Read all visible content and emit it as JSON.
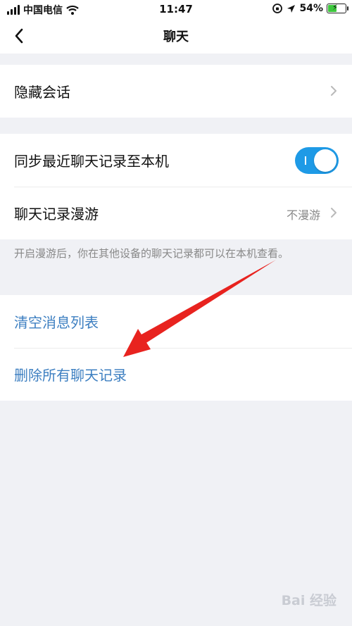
{
  "status": {
    "carrier": "中国电信",
    "time": "11:47",
    "battery_percent": "54%",
    "battery_level": 0.54
  },
  "nav": {
    "title": "聊天"
  },
  "hide_group": {
    "hide_sessions": "隐藏会话"
  },
  "sync_group": {
    "sync_recent": "同步最近聊天记录至本机",
    "sync_on": true,
    "roaming_label": "聊天记录漫游",
    "roaming_value": "不漫游"
  },
  "note": "开启漫游后，你在其他设备的聊天记录都可以在本机查看。",
  "action_group": {
    "clear_list": "清空消息列表",
    "delete_all": "删除所有聊天记录"
  },
  "colors": {
    "accent": "#1e9ae6",
    "link": "#3d7fc1",
    "annotation_arrow": "#e8231f"
  },
  "watermark": "Bai 经验"
}
